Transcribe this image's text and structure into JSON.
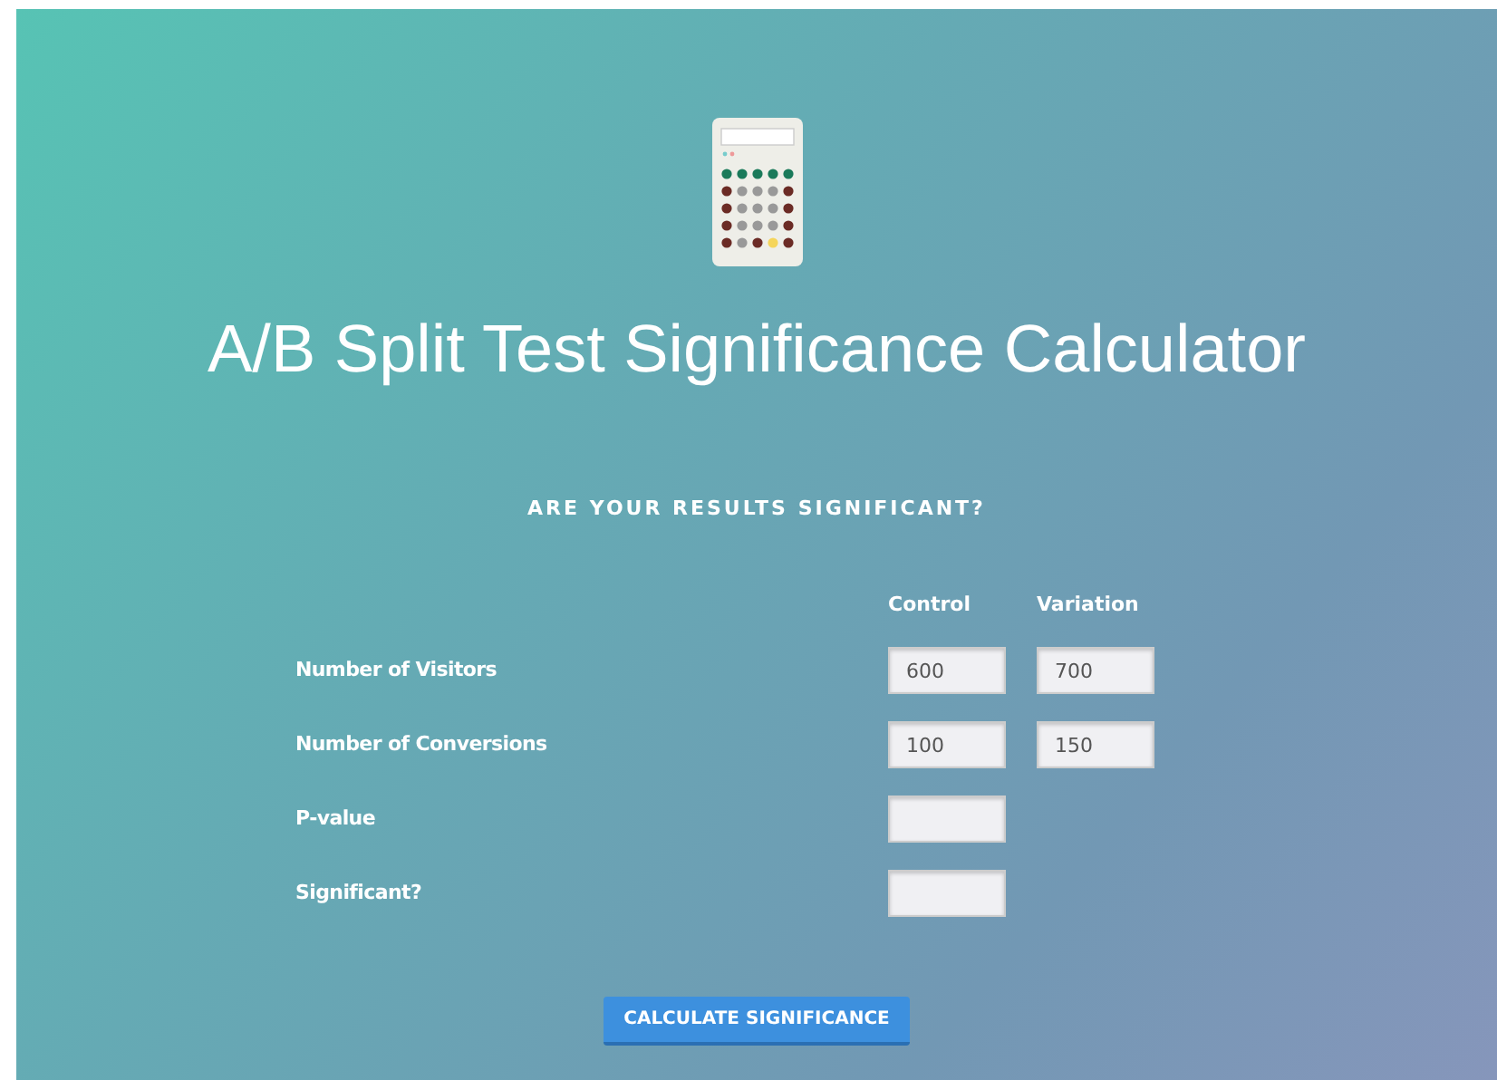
{
  "title": "A/B Split Test Significance Calculator",
  "subtitle": "ARE YOUR RESULTS SIGNIFICANT?",
  "columns": [
    "Control",
    "Variation"
  ],
  "rows": [
    {
      "label": "Number of Visitors",
      "fields": [
        {
          "kind": "field",
          "value": "600"
        },
        {
          "kind": "field",
          "value": "700"
        }
      ]
    },
    {
      "label": "Number of Conversions",
      "fields": [
        {
          "kind": "field",
          "value": "100"
        },
        {
          "kind": "field",
          "value": "150"
        }
      ]
    },
    {
      "label": "P-value",
      "fields": [
        {
          "kind": "field"
        }
      ]
    },
    {
      "label": "Significant?",
      "fields": [
        {
          "kind": "field"
        }
      ]
    }
  ],
  "button": "CALCULATE SIGNIFICANCE"
}
